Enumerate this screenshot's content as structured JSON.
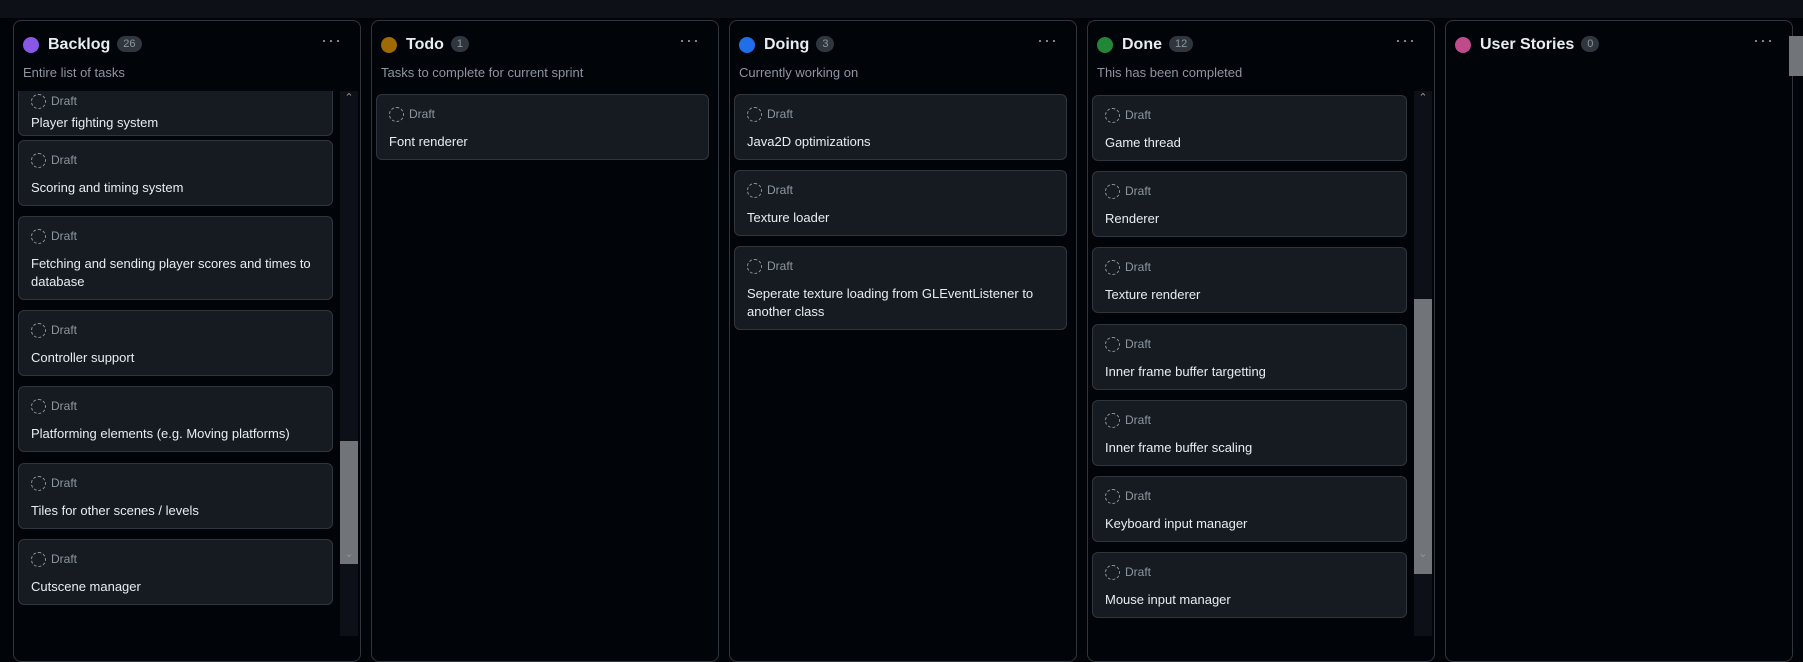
{
  "board": {
    "columns": [
      {
        "id": "backlog",
        "title": "Backlog",
        "count": "26",
        "description": "Entire list of tasks",
        "color": "#8957e5",
        "cards": [
          {
            "status": "Draft",
            "title": "Player fighting system"
          },
          {
            "status": "Draft",
            "title": "Scoring and timing system"
          },
          {
            "status": "Draft",
            "title": "Fetching and sending player scores and times to database"
          },
          {
            "status": "Draft",
            "title": "Controller support"
          },
          {
            "status": "Draft",
            "title": "Platforming elements (e.g. Moving platforms)"
          },
          {
            "status": "Draft",
            "title": "Tiles for other scenes / levels"
          },
          {
            "status": "Draft",
            "title": "Cutscene manager"
          }
        ]
      },
      {
        "id": "todo",
        "title": "Todo",
        "count": "1",
        "description": "Tasks to complete for current sprint",
        "color": "#9e6a03",
        "cards": [
          {
            "status": "Draft",
            "title": "Font renderer"
          }
        ]
      },
      {
        "id": "doing",
        "title": "Doing",
        "count": "3",
        "description": "Currently working on",
        "color": "#1f6feb",
        "cards": [
          {
            "status": "Draft",
            "title": "Java2D optimizations"
          },
          {
            "status": "Draft",
            "title": "Texture loader"
          },
          {
            "status": "Draft",
            "title": "Seperate texture loading from GLEventListener to another class"
          }
        ]
      },
      {
        "id": "done",
        "title": "Done",
        "count": "12",
        "description": "This has been completed",
        "color": "#238636",
        "cards": [
          {
            "status": "Draft",
            "title": "Game thread"
          },
          {
            "status": "Draft",
            "title": "Renderer"
          },
          {
            "status": "Draft",
            "title": "Texture renderer"
          },
          {
            "status": "Draft",
            "title": "Inner frame buffer targetting"
          },
          {
            "status": "Draft",
            "title": "Inner frame buffer scaling"
          },
          {
            "status": "Draft",
            "title": "Keyboard input manager"
          },
          {
            "status": "Draft",
            "title": "Mouse input manager"
          }
        ]
      },
      {
        "id": "user-stories",
        "title": "User Stories",
        "count": "0",
        "description": "",
        "color": "#bf4b8a",
        "cards": []
      }
    ],
    "more_icon": "ellipsis-icon",
    "draft_icon": "dashed-circle-icon"
  }
}
